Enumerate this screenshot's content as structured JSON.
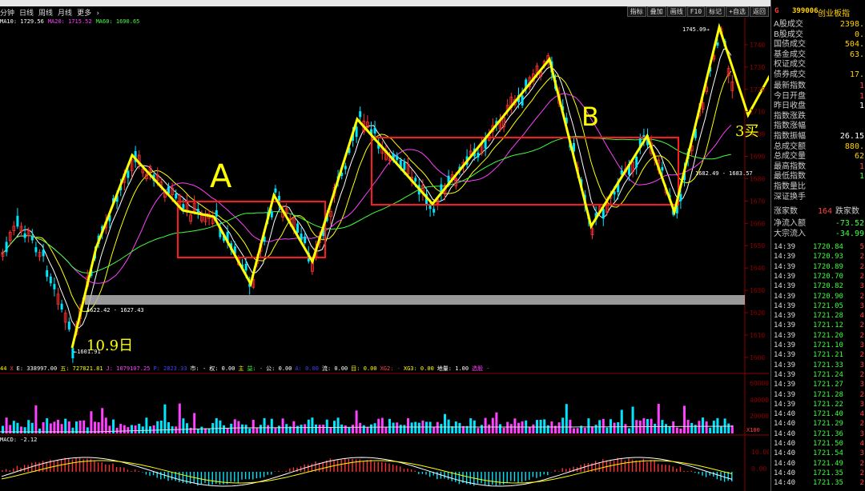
{
  "menu": {
    "left_items": [
      "分钟",
      "日线",
      "周线",
      "月线",
      "更多 ›"
    ],
    "right_buttons": [
      "指标",
      "叠加",
      "画线",
      "F10",
      "标记",
      "+自选",
      "返回"
    ]
  },
  "ma_legend": [
    {
      "text": "MA10: 1729.56",
      "color": "#ffffff"
    },
    {
      "text": "MA20: 1715.52",
      "color": "#ff40ff"
    },
    {
      "text": "MA60: 1690.65",
      "color": "#40ff40"
    }
  ],
  "price_axis": {
    "ticks": [
      "1740",
      "1730",
      "1720",
      "1710",
      "1700",
      "1690",
      "1680",
      "1670",
      "1660",
      "1650",
      "1640",
      "1630",
      "1620",
      "1610",
      "1600"
    ],
    "ymin": 1596,
    "ymax": 1750
  },
  "annotations": {
    "A": "A",
    "B": "B",
    "buy3": "3买",
    "date": "10.9日"
  },
  "price_tags": {
    "low": "←1601.91",
    "high": "1745.09→",
    "band_left": "1622.42 - 1627.43",
    "band_right": "1682.49 - 1683.57"
  },
  "indicator_legend": [
    {
      "text": "44",
      "color": "#ffff00"
    },
    {
      "text": "X",
      "color": "#ff4040"
    },
    {
      "text": "E: 338997.00",
      "color": "#ffffff"
    },
    {
      "text": "五: 727821.81",
      "color": "#ffff00"
    },
    {
      "text": "J: 1079107.25",
      "color": "#ff40ff"
    },
    {
      "text": "P: 2823.33",
      "color": "#4040ff"
    },
    {
      "text": "市: -",
      "color": "#ffffff"
    },
    {
      "text": "权: 0.00",
      "color": "#ffffff"
    },
    {
      "text": "主",
      "color": "#ffff00"
    },
    {
      "text": "益: -",
      "color": "#40ff40"
    },
    {
      "text": "公: 0.00",
      "color": "#ffffff"
    },
    {
      "text": "A: 0.00",
      "color": "#4040ff"
    },
    {
      "text": "流: 0.00",
      "color": "#ffffff"
    },
    {
      "text": "目: 0.00",
      "color": "#ffff00"
    },
    {
      "text": "XG2: -",
      "color": "#ff4040"
    },
    {
      "text": "XG3: 0.00",
      "color": "#ffff00"
    },
    {
      "text": "地量: 1.00",
      "color": "#ffffff"
    },
    {
      "text": "选股 -",
      "color": "#ff40ff"
    }
  ],
  "volume_axis": [
    "60000",
    "40000",
    "20000"
  ],
  "volume_unit": "X100",
  "macd": {
    "label": "MACD: -2.12",
    "ticks": [
      "10.00",
      "0.00"
    ]
  },
  "sidebar": {
    "flag": "G",
    "code": "399006",
    "name": "创业板指",
    "stats": [
      {
        "label": "A股成交",
        "value": "2398.",
        "color": "#ffd000"
      },
      {
        "label": "B股成交",
        "value": "0.",
        "color": "#ffd000"
      },
      {
        "label": "国债成交",
        "value": "504.",
        "color": "#ffd000"
      },
      {
        "label": "基金成交",
        "value": "63.",
        "color": "#ffd000"
      },
      {
        "label": "权证成交",
        "value": "",
        "color": "#ffd000"
      },
      {
        "label": "债券成交",
        "value": "17.",
        "color": "#ffd000"
      },
      {
        "label": "最新指数",
        "value": "1",
        "color": "#ff4040"
      },
      {
        "label": "今日开盘",
        "value": "1",
        "color": "#ff4040"
      },
      {
        "label": "昨日收盘",
        "value": "1",
        "color": "#ffffff"
      },
      {
        "label": "指数涨跌",
        "value": "",
        "color": "#ff4040"
      },
      {
        "label": "指数涨幅",
        "value": "",
        "color": "#ff4040"
      },
      {
        "label": "指数振幅",
        "value": "26.15",
        "color": "#ffffff"
      },
      {
        "label": "总成交额",
        "value": "880.",
        "color": "#ffd000"
      },
      {
        "label": "总成交量",
        "value": "62",
        "color": "#ffd000"
      },
      {
        "label": "最高指数",
        "value": "1",
        "color": "#ff4040"
      },
      {
        "label": "最低指数",
        "value": "1",
        "color": "#40ff40"
      },
      {
        "label": "指数量比",
        "value": "",
        "color": "#ffffff"
      },
      {
        "label": "深证换手",
        "value": "",
        "color": "#ffffff"
      }
    ],
    "breadth": {
      "up_label": "涨家数",
      "up": "164",
      "down_label": "跌家数"
    },
    "flows": [
      {
        "label": "净流入额",
        "value": "-73.52",
        "color": "#40ff40"
      },
      {
        "label": "大宗流入",
        "value": "-34.99",
        "color": "#40ff40"
      }
    ],
    "ticks": [
      {
        "t": "14:39",
        "p": "1720.84",
        "v": "5"
      },
      {
        "t": "14:39",
        "p": "1720.93",
        "v": "2"
      },
      {
        "t": "14:39",
        "p": "1720.89",
        "v": "2"
      },
      {
        "t": "14:39",
        "p": "1720.70",
        "v": "2"
      },
      {
        "t": "14:39",
        "p": "1720.82",
        "v": "3"
      },
      {
        "t": "14:39",
        "p": "1720.90",
        "v": "2"
      },
      {
        "t": "14:39",
        "p": "1721.05",
        "v": "3"
      },
      {
        "t": "14:39",
        "p": "1721.28",
        "v": "4"
      },
      {
        "t": "14:39",
        "p": "1721.12",
        "v": "2"
      },
      {
        "t": "14:39",
        "p": "1721.20",
        "v": "2"
      },
      {
        "t": "14:39",
        "p": "1721.10",
        "v": "3"
      },
      {
        "t": "14:39",
        "p": "1721.21",
        "v": "2"
      },
      {
        "t": "14:39",
        "p": "1721.33",
        "v": "3"
      },
      {
        "t": "14:39",
        "p": "1721.24",
        "v": "2"
      },
      {
        "t": "14:39",
        "p": "1721.27",
        "v": "3"
      },
      {
        "t": "14:39",
        "p": "1721.28",
        "v": "2"
      },
      {
        "t": "14:39",
        "p": "1721.22",
        "v": "3"
      },
      {
        "t": "14:40",
        "p": "1721.40",
        "v": "4"
      },
      {
        "t": "14:40",
        "p": "1721.29",
        "v": "2"
      },
      {
        "t": "14:40",
        "p": "1721.36",
        "v": "3"
      },
      {
        "t": "14:40",
        "p": "1721.50",
        "v": "4"
      },
      {
        "t": "14:40",
        "p": "1721.54",
        "v": "3"
      },
      {
        "t": "14:40",
        "p": "1721.49",
        "v": "2"
      },
      {
        "t": "14:40",
        "p": "1721.35",
        "v": "2"
      },
      {
        "t": "14:40",
        "p": "1721.35",
        "v": "2"
      }
    ]
  }
}
